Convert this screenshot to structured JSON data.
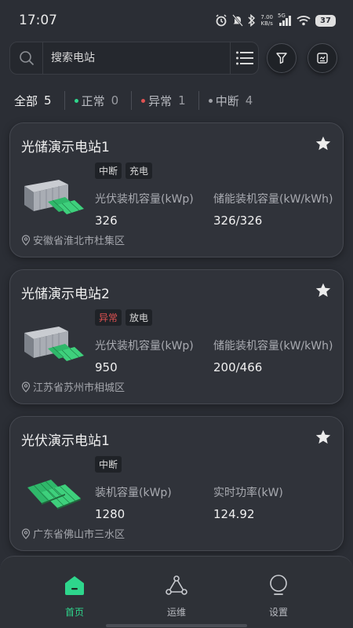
{
  "status_bar": {
    "time": "17:07",
    "speed_top": "7.00",
    "speed_bottom": "KB/s",
    "network": "5G",
    "battery": "37"
  },
  "search": {
    "placeholder": "搜索电站"
  },
  "tabs": [
    {
      "label": "全部",
      "count": "5",
      "dot_color": ""
    },
    {
      "label": "正常",
      "count": "0",
      "dot_color": "#2ed68c"
    },
    {
      "label": "异常",
      "count": "1",
      "dot_color": "#e05252"
    },
    {
      "label": "中断",
      "count": "4",
      "dot_color": "#a0a2a8"
    }
  ],
  "stations": [
    {
      "name": "光储演示电站1",
      "badges": [
        {
          "text": "中断",
          "warn": false
        },
        {
          "text": "充电",
          "warn": false
        }
      ],
      "label1": "光伏装机容量(kWp)",
      "value1": "326",
      "label2": "储能装机容量(kW/kWh)",
      "value2": "326/326",
      "location": "安徽省淮北市杜集区",
      "icon": "storage-station-icon"
    },
    {
      "name": "光储演示电站2",
      "badges": [
        {
          "text": "异常",
          "warn": true
        },
        {
          "text": "放电",
          "warn": false
        }
      ],
      "label1": "光伏装机容量(kWp)",
      "value1": "950",
      "label2": "储能装机容量(kW/kWh)",
      "value2": "200/466",
      "location": "江苏省苏州市相城区",
      "icon": "storage-station-icon"
    },
    {
      "name": "光伏演示电站1",
      "badges": [
        {
          "text": "中断",
          "warn": false
        }
      ],
      "label1": "装机容量(kWp)",
      "value1": "1280",
      "label2": "实时功率(kW)",
      "value2": "124.92",
      "location": "广东省佛山市三水区",
      "icon": "solar-panel-icon"
    }
  ],
  "nav": [
    {
      "label": "首页",
      "icon": "home-icon",
      "active": true
    },
    {
      "label": "运维",
      "icon": "operations-icon",
      "active": false
    },
    {
      "label": "设置",
      "icon": "settings-bulb-icon",
      "active": false
    }
  ],
  "colors": {
    "accent": "#2ed68c",
    "warning": "#e05252",
    "background": "#2b2e35",
    "card": "#30333a"
  }
}
